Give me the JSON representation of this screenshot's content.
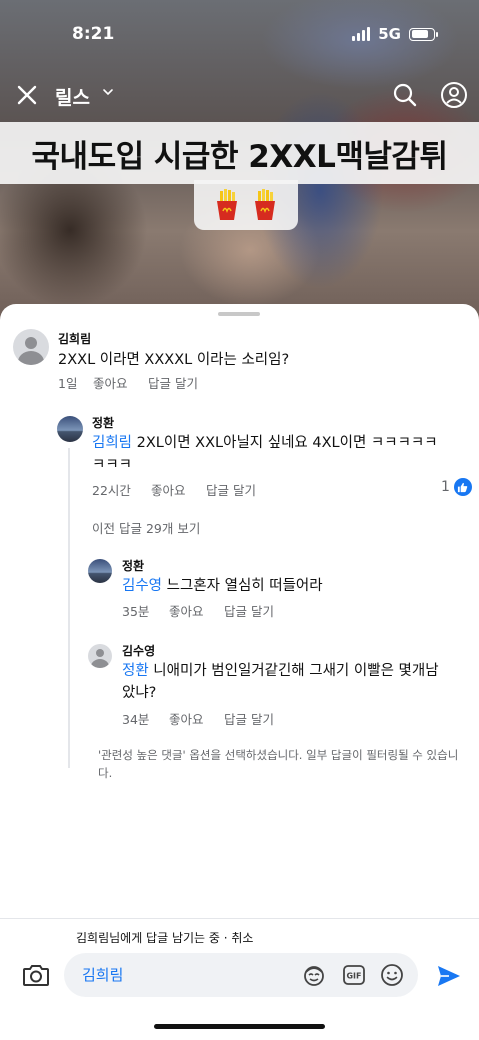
{
  "status_bar": {
    "time": "8:21",
    "network": "5G"
  },
  "reel_header": {
    "title": "릴스"
  },
  "reel_caption": {
    "text": "국내도입 시급한 2XXL맥날감튀"
  },
  "comments": [
    {
      "author": "김희림",
      "text": "2XXL 이라면 XXXXL 이라는 소리임?",
      "time": "1일",
      "like_label": "좋아요",
      "reply_label": "답글 달기"
    },
    {
      "author": "정환",
      "mention": "김희림",
      "text": " 2XL이면 XXL아닐지 싶네요 4XL이면 ㅋㅋㅋㅋㅋ",
      "text2": "ㅋㅋㅋ",
      "time": "22시간",
      "like_label": "좋아요",
      "reply_label": "답글 달기",
      "like_count": "1"
    },
    {
      "author": "정환",
      "mention": "김수영",
      "text": " 느그혼자 열심히 떠들어라",
      "time": "35분",
      "like_label": "좋아요",
      "reply_label": "답글 달기"
    },
    {
      "author": "김수영",
      "mention": "정환",
      "text": " 니애미가 범인일거같긴해 그새기 이빨은 몇개남",
      "text2": "았냐?",
      "time": "34분",
      "like_label": "좋아요",
      "reply_label": "답글 달기"
    }
  ],
  "more_replies": "이전 답글 29개 보기",
  "notice": "'관련성 높은 댓글' 옵션을 선택하셨습니다. 일부 답글이 필터링될 수 있습니다.",
  "composer": {
    "replying_to": "김희림님에게 답글 남기는 중",
    "separator": " · ",
    "cancel": "취소",
    "value": "김희림"
  },
  "colors": {
    "accent": "#1877f2",
    "meta": "#65676b"
  },
  "icons": [
    "close-icon",
    "chevron-down-icon",
    "search-icon",
    "profile-icon",
    "fries-icon",
    "like-icon",
    "camera-icon",
    "avatar-sticker-icon",
    "gif-icon",
    "emoji-icon",
    "send-icon"
  ]
}
